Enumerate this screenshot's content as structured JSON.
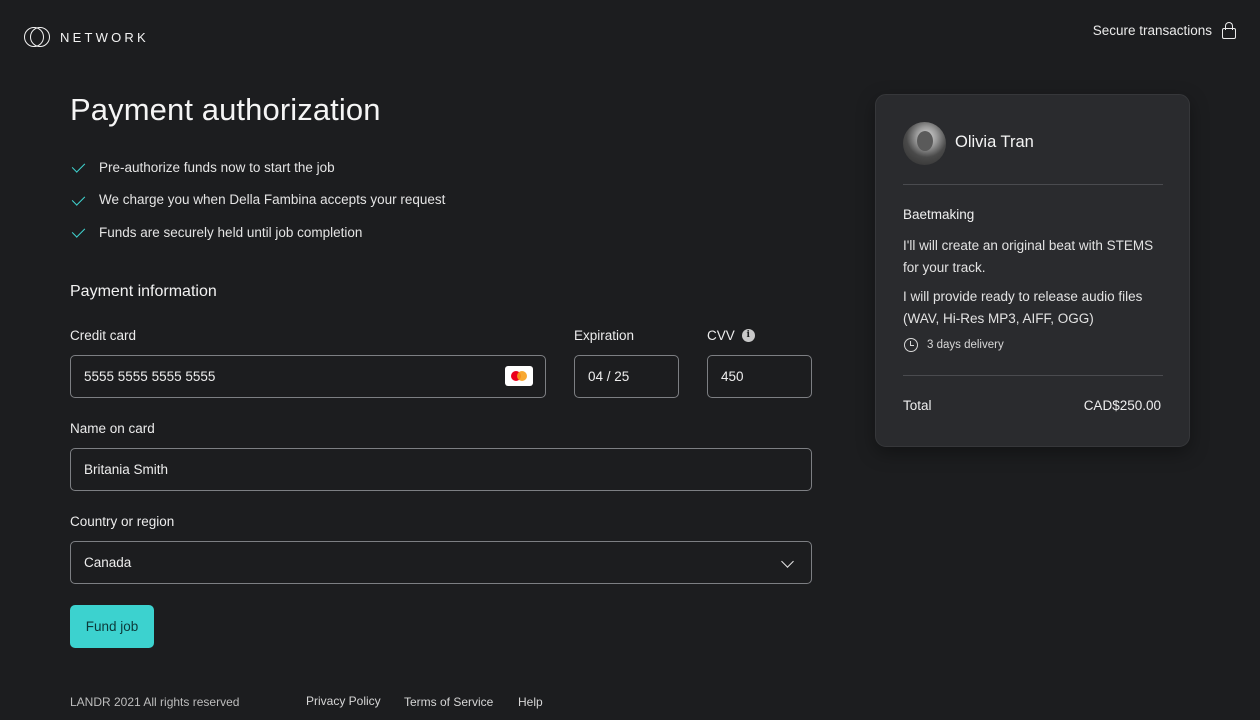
{
  "header": {
    "brand": "NETWORK",
    "secure_label": "Secure transactions"
  },
  "page": {
    "title": "Payment authorization",
    "checks": [
      "Pre-authorize funds now to start the job",
      "We charge you when Della Fambina accepts your request",
      "Funds are securely held until job completion"
    ]
  },
  "form": {
    "section_title": "Payment information",
    "credit_card": {
      "label": "Credit card",
      "value": "5555 5555 5555 5555",
      "brand_icon": "mastercard-icon"
    },
    "expiration": {
      "label": "Expiration",
      "value": "04 / 25"
    },
    "cvv": {
      "label": "CVV",
      "value": "450",
      "info_icon": "info-icon"
    },
    "name": {
      "label": "Name on card",
      "value": "Britania Smith"
    },
    "country": {
      "label": "Country or region",
      "value": "Canada"
    },
    "submit_label": "Fund job"
  },
  "summary": {
    "seller_name": "Olivia Tran",
    "service_title": "Baetmaking",
    "desc_1": "I'll will create an original beat with STEMS for your track.",
    "desc_2": "I will provide ready to release audio files (WAV, Hi-Res MP3, AIFF, OGG)",
    "delivery": "3 days delivery",
    "total_label": "Total",
    "total_value": "CAD$250.00"
  },
  "footer": {
    "copyright": "LANDR 2021 All rights reserved",
    "links": [
      "Privacy Policy",
      "Terms of Service",
      "Help"
    ]
  },
  "colors": {
    "background": "#1c1d1f",
    "accent": "#3cd2cf",
    "card": "#2a2b2e",
    "field_border": "#7d7f83"
  }
}
